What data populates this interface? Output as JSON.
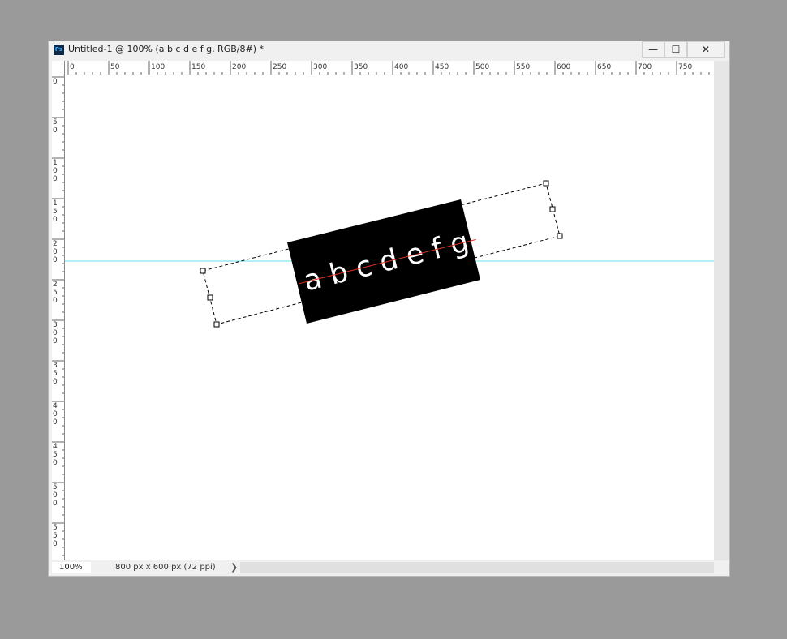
{
  "app": {
    "icon_label": "Ps",
    "title": "Untitled-1 @ 100% (a b c d e f g, RGB/8#) *"
  },
  "window_controls": {
    "minimize_label": "—",
    "maximize_label": "☐",
    "close_label": "✕"
  },
  "rulers": {
    "horizontal": [
      "0",
      "50",
      "100",
      "150",
      "200",
      "250",
      "300",
      "350",
      "400",
      "450",
      "500",
      "550",
      "600",
      "650",
      "700",
      "750"
    ],
    "vertical": [
      "0",
      "50",
      "100",
      "150",
      "200",
      "250",
      "300",
      "350",
      "400",
      "450",
      "500",
      "550"
    ]
  },
  "canvas": {
    "text_layer": "a b c d e f g",
    "guide_color": "#66e0ee"
  },
  "status": {
    "zoom": "100%",
    "doc_info": "800 px x 600 px (72 ppi)",
    "arrow": "❯"
  }
}
